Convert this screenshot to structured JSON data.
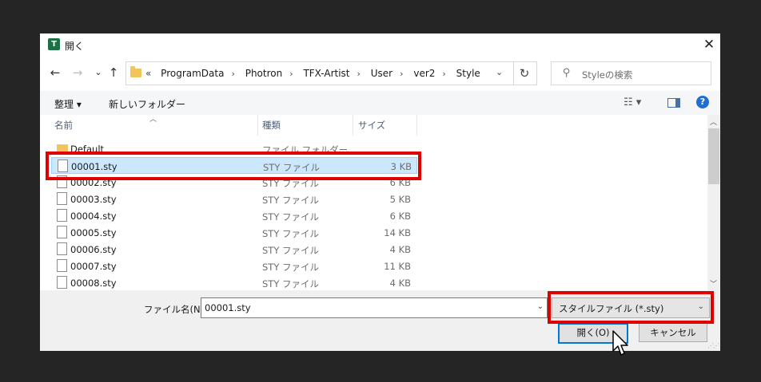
{
  "dialog": {
    "title": "開く",
    "app_icon_letter": "T",
    "close_glyph": "✕"
  },
  "nav": {
    "back_glyph": "←",
    "forward_glyph": "→",
    "recent_glyph": "⌄",
    "up_glyph": "↑",
    "overflow_glyph": "«",
    "breadcrumbs": [
      "ProgramData",
      "Photron",
      "TFX-Artist",
      "User",
      "ver2",
      "Style"
    ],
    "separator": "›",
    "refresh_glyph": "↻",
    "search_placeholder": "Styleの検索"
  },
  "toolbar": {
    "organize_label": "整理 ▾",
    "new_folder_label": "新しいフォルダー",
    "view_glyph": "☷ ▾",
    "help_glyph": "?"
  },
  "columns": {
    "name": "名前",
    "type": "種類",
    "size": "サイズ"
  },
  "files": [
    {
      "name": "Default",
      "type": "ファイル フォルダー",
      "size": "",
      "kind": "folder"
    },
    {
      "name": "00001.sty",
      "type": "STY ファイル",
      "size": "3 KB",
      "kind": "file",
      "selected": true
    },
    {
      "name": "00002.sty",
      "type": "STY ファイル",
      "size": "6 KB",
      "kind": "file"
    },
    {
      "name": "00003.sty",
      "type": "STY ファイル",
      "size": "5 KB",
      "kind": "file"
    },
    {
      "name": "00004.sty",
      "type": "STY ファイル",
      "size": "6 KB",
      "kind": "file"
    },
    {
      "name": "00005.sty",
      "type": "STY ファイル",
      "size": "14 KB",
      "kind": "file"
    },
    {
      "name": "00006.sty",
      "type": "STY ファイル",
      "size": "4 KB",
      "kind": "file"
    },
    {
      "name": "00007.sty",
      "type": "STY ファイル",
      "size": "11 KB",
      "kind": "file"
    },
    {
      "name": "00008.sty",
      "type": "STY ファイル",
      "size": "4 KB",
      "kind": "file"
    }
  ],
  "bottom": {
    "filename_label": "ファイル名(N):",
    "filename_value": "00001.sty",
    "filter_value": "スタイルファイル (*.sty)",
    "open_label": "開く(O)",
    "cancel_label": "キャンセル"
  },
  "colors": {
    "highlight": "#e00000",
    "selection": "#cce8ff",
    "accent": "#0078d7"
  }
}
